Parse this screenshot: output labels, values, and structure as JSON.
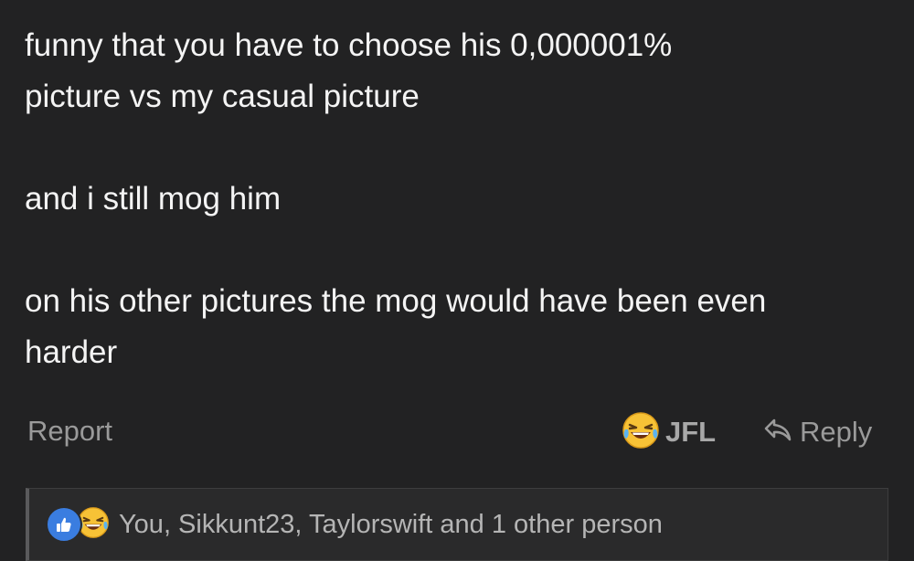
{
  "post": {
    "lines": [
      "funny that you have to choose his 0,000001%",
      "picture vs my casual picture",
      "",
      "and i still mog him",
      "",
      "on his other pictures the mog would have been even",
      "harder"
    ]
  },
  "actions": {
    "report_label": "Report",
    "jfl_label": "JFL",
    "reply_label": "Reply"
  },
  "reactions": {
    "summary": "You, Sikkunt23, Taylorswift and 1 other person",
    "icons": [
      "like-icon",
      "laugh-cry-icon"
    ]
  },
  "colors": {
    "background": "#222223",
    "text": "#f4f4f4",
    "muted": "#9a9a9a",
    "like_blue": "#3a7de0",
    "emoji_yellow": "#f7c236"
  }
}
